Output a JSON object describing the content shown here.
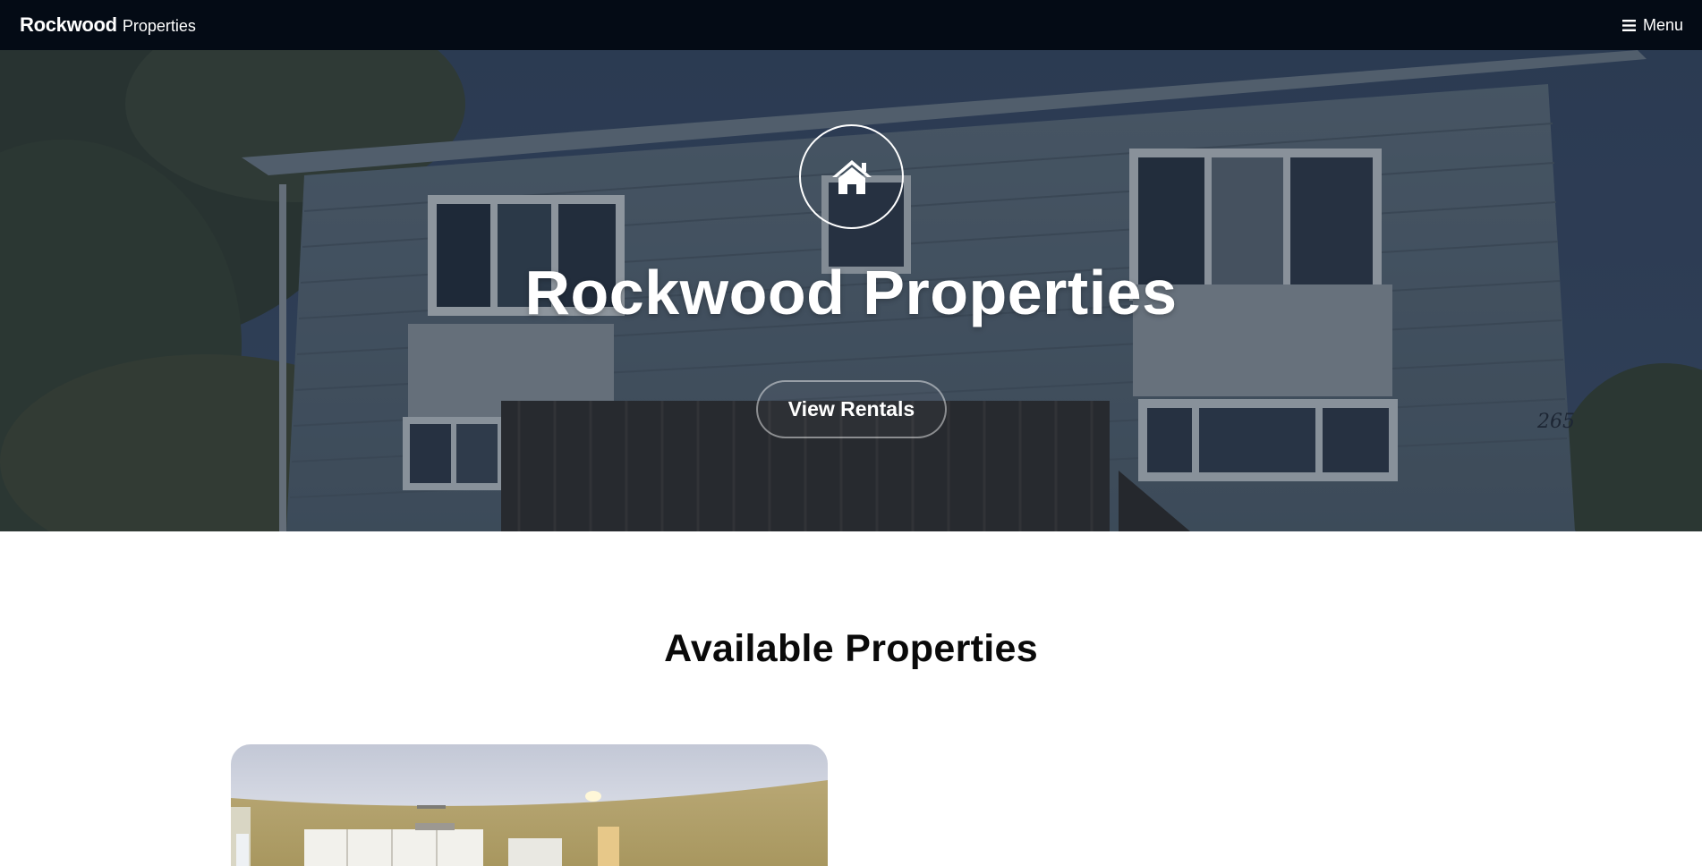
{
  "navbar": {
    "brand_strong": "Rockwood",
    "brand_light": "Properties",
    "menu_label": "Menu",
    "menu_icon": "hamburger-icon"
  },
  "hero": {
    "icon": "home-icon",
    "title": "Rockwood Properties",
    "button_label": "View Rentals",
    "house_number": "265"
  },
  "properties": {
    "heading": "Available Properties"
  },
  "colors": {
    "navbar_bg": "#040b15",
    "hero_text": "#ffffff",
    "heading_text": "#0a0a0a"
  }
}
